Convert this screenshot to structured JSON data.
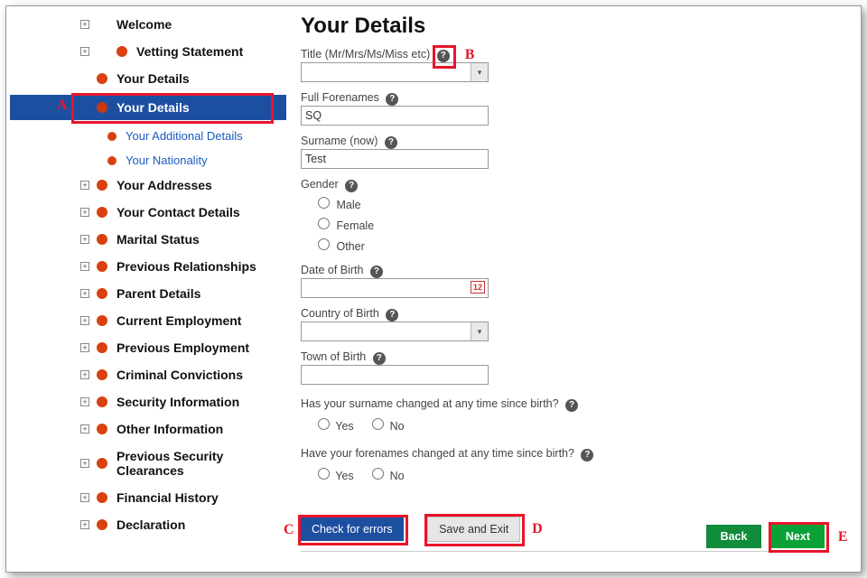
{
  "sidebar": {
    "items": [
      {
        "label": "Welcome",
        "level": 0,
        "dot": false,
        "expander": true
      },
      {
        "label": "Vetting Statement",
        "level": 0,
        "dot": true,
        "expander": true
      },
      {
        "label": "Your Details",
        "level": 1,
        "dot": true
      },
      {
        "label": "Your Details",
        "level": 1,
        "dot": true,
        "active": true
      },
      {
        "label": "Your Additional Details",
        "level": 2,
        "dot": true
      },
      {
        "label": "Your Nationality",
        "level": 2,
        "dot": true
      },
      {
        "label": "Your Addresses",
        "level": 1,
        "dot": true,
        "expander": true
      },
      {
        "label": "Your Contact Details",
        "level": 1,
        "dot": true,
        "expander": true
      },
      {
        "label": "Marital Status",
        "level": 1,
        "dot": true,
        "expander": true
      },
      {
        "label": "Previous Relationships",
        "level": 1,
        "dot": true,
        "expander": true
      },
      {
        "label": "Parent Details",
        "level": 1,
        "dot": true,
        "expander": true
      },
      {
        "label": "Current Employment",
        "level": 1,
        "dot": true,
        "expander": true
      },
      {
        "label": "Previous Employment",
        "level": 1,
        "dot": true,
        "expander": true
      },
      {
        "label": "Criminal Convictions",
        "level": 1,
        "dot": true,
        "expander": true
      },
      {
        "label": "Security Information",
        "level": 1,
        "dot": true,
        "expander": true
      },
      {
        "label": "Other Information",
        "level": 1,
        "dot": true,
        "expander": true
      },
      {
        "label": "Previous Security Clearances",
        "level": 1,
        "dot": true,
        "expander": true
      },
      {
        "label": "Financial History",
        "level": 1,
        "dot": true,
        "expander": true
      },
      {
        "label": "Declaration",
        "level": 1,
        "dot": true,
        "expander": true
      }
    ]
  },
  "page": {
    "title": "Your Details"
  },
  "form": {
    "title_label": "Title (Mr/Mrs/Ms/Miss etc)",
    "title_value": "",
    "forenames_label": "Full Forenames",
    "forenames_value": "SQ",
    "surname_label": "Surname (now)",
    "surname_value": "Test",
    "gender_label": "Gender",
    "gender_options": {
      "male": "Male",
      "female": "Female",
      "other": "Other"
    },
    "dob_label": "Date of Birth",
    "dob_value": "",
    "cob_label": "Country of Birth",
    "cob_value": "",
    "tob_label": "Town of Birth",
    "tob_value": "",
    "q_surname": "Has your surname changed at any time since birth?",
    "q_forenames": "Have your forenames changed at any time since birth?",
    "yes": "Yes",
    "no": "No"
  },
  "buttons": {
    "check": "Check for errors",
    "save": "Save and Exit",
    "back": "Back",
    "next": "Next"
  },
  "callouts": {
    "A": "A",
    "B": "B",
    "C": "C",
    "D": "D",
    "E": "E"
  },
  "icons": {
    "help": "?",
    "expander": "+",
    "calendar": "12",
    "dropdown": "▾"
  }
}
